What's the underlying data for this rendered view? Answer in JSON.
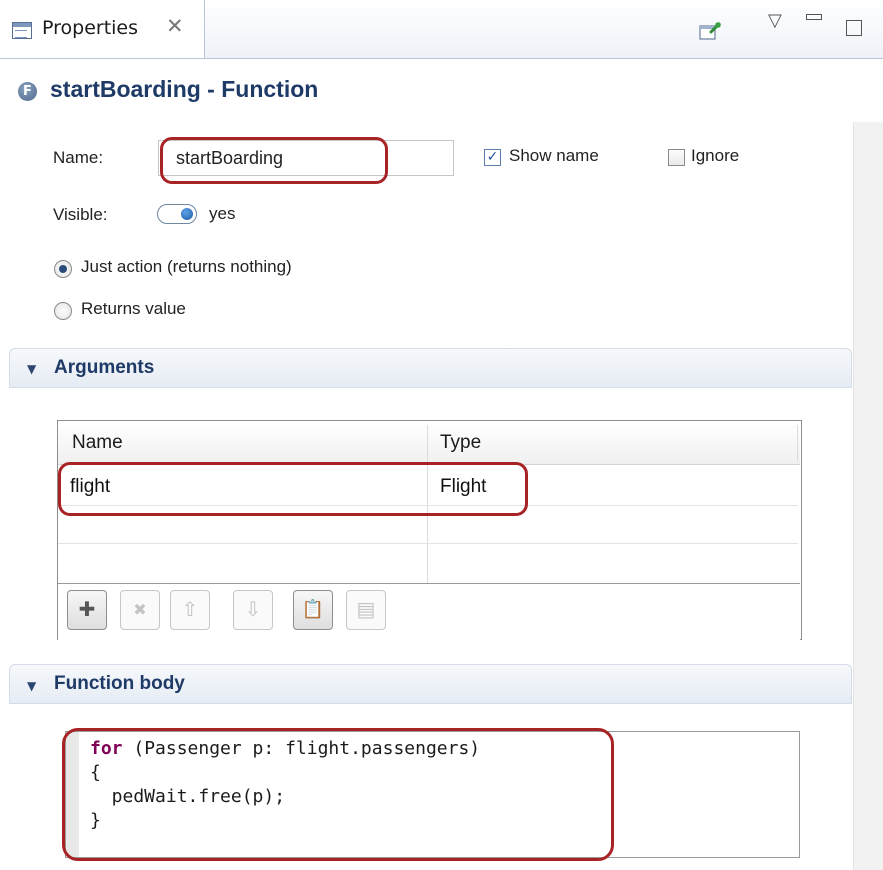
{
  "tab": {
    "label": "Properties",
    "close_glyph": "✕",
    "icon": "properties-view-icon"
  },
  "toolbar": {
    "pin_icon": "pin-icon",
    "menu_glyph": "▽",
    "minimize_glyph": "▭",
    "maximize_icon": "maximize-icon"
  },
  "title": {
    "icon_letter": "F",
    "text": "startBoarding - Function"
  },
  "general": {
    "name_label": "Name:",
    "name_value": "startBoarding",
    "show_name_label": "Show name",
    "show_name_checked": true,
    "ignore_label": "Ignore",
    "ignore_checked": false,
    "visible_label": "Visible:",
    "visible_value": "yes",
    "radio_just_action": "Just action (returns nothing)",
    "radio_returns_value": "Returns value",
    "selected_radio": "just_action"
  },
  "arguments": {
    "header": "Arguments",
    "columns": [
      "Name",
      "Type"
    ],
    "rows": [
      {
        "name": "flight",
        "type": "Flight"
      }
    ],
    "buttons": [
      {
        "name": "add-icon",
        "glyph": "✚",
        "enabled": true
      },
      {
        "name": "delete-icon",
        "glyph": "✖",
        "enabled": false
      },
      {
        "name": "move-up-icon",
        "glyph": "⇧",
        "enabled": false
      },
      {
        "name": "move-down-icon",
        "glyph": "⇩",
        "enabled": false
      },
      {
        "name": "paste-icon",
        "glyph": "📋",
        "enabled": true
      },
      {
        "name": "copy-icon",
        "glyph": "▤",
        "enabled": false
      }
    ]
  },
  "function_body": {
    "header": "Function body",
    "line1_keyword": "for",
    "line1_rest": " (Passenger p: flight.passengers)",
    "line2": "{",
    "line3": "  pedWait.free(p);",
    "line4": "}"
  },
  "colors": {
    "title": "#1e3a66",
    "highlight": "#a82326",
    "keyword": "#7f0055"
  }
}
